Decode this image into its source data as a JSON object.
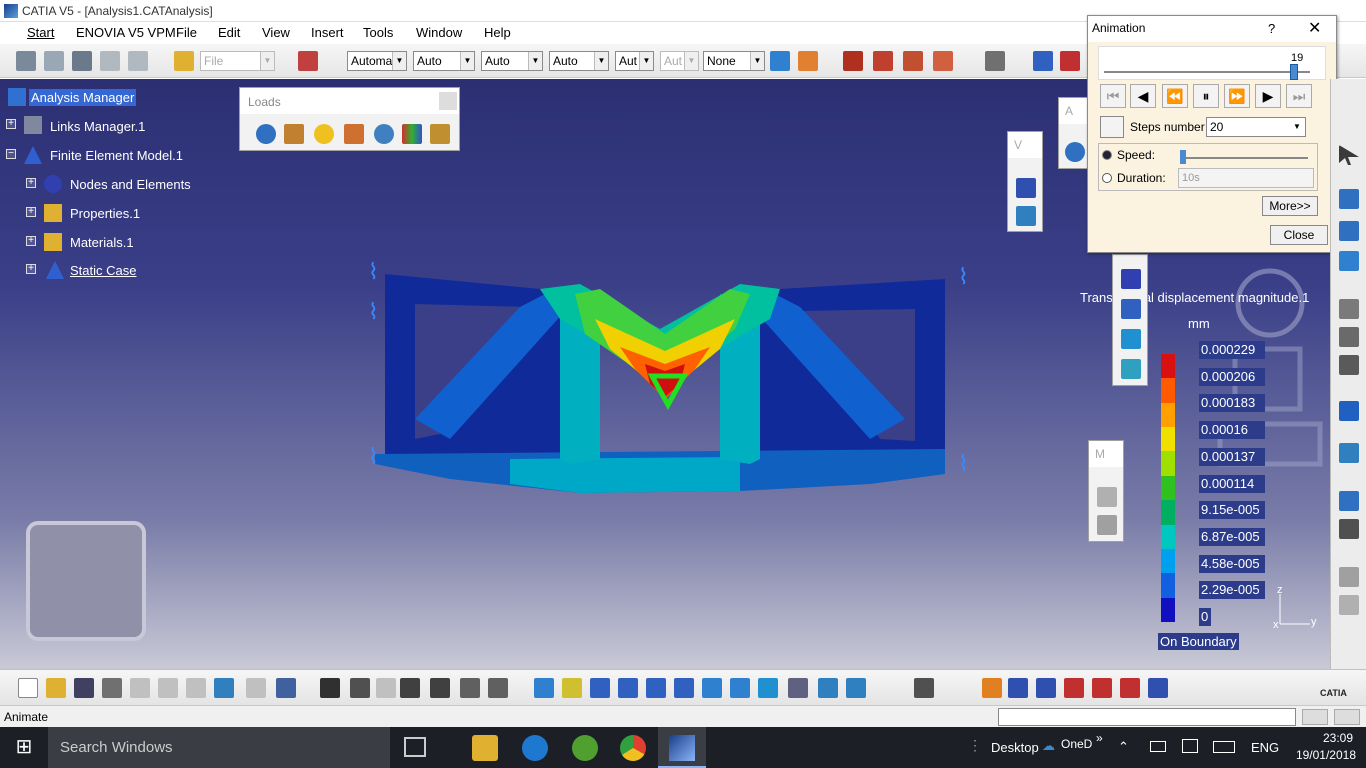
{
  "window": {
    "title": "CATIA V5 - [Analysis1.CATAnalysis]"
  },
  "menu": {
    "items": [
      "Start",
      "ENOVIA V5 VPM",
      "File",
      "Edit",
      "View",
      "Insert",
      "Tools",
      "Window",
      "Help"
    ]
  },
  "toolbar": {
    "file_combo": "File",
    "combos": [
      "Automa",
      "Auto",
      "Auto",
      "Auto",
      "Aut",
      "Aut",
      "None"
    ]
  },
  "tree": {
    "root": "Analysis Manager",
    "items": [
      "Links Manager.1",
      "Finite Element Model.1",
      "Nodes and Elements",
      "Properties.1",
      "Materials.1",
      "Static Case"
    ]
  },
  "loads_toolbar": {
    "title": "Loads"
  },
  "small_toolbars": {
    "v": "V",
    "a": "A",
    "m": "M"
  },
  "animation": {
    "title": "Animation",
    "help": "?",
    "slider_value": "19",
    "slider_fraction": 0.95,
    "steps_label": "Steps number",
    "steps_value": "20",
    "speed_label": "Speed:",
    "duration_label": "Duration:",
    "duration_value": "10s",
    "more_button": "More>>",
    "close_button": "Close"
  },
  "legend": {
    "title": "Translational displacement magnitude.1",
    "unit": "mm",
    "values": [
      "0.000229",
      "0.000206",
      "0.000183",
      "0.00016",
      "0.000137",
      "0.000114",
      "9.15e-005",
      "6.87e-005",
      "4.58e-005",
      "2.29e-005",
      "0"
    ],
    "colors": [
      "#d81010",
      "#ff5a00",
      "#ffa000",
      "#f0e000",
      "#a0e000",
      "#30c020",
      "#00b060",
      "#00c8c0",
      "#00a0f0",
      "#1060e0",
      "#1010c0"
    ],
    "footer": "On Boundary"
  },
  "axis": {
    "z": "z",
    "y": "y",
    "x": "x"
  },
  "status": {
    "text": "Animate"
  },
  "taskbar": {
    "search": "Search Windows",
    "desktop": "Desktop",
    "onedrive": "OneD",
    "lang": "ENG",
    "time": "23:09",
    "date": "19/01/2018"
  },
  "brand": {
    "logo": "CATIA"
  }
}
